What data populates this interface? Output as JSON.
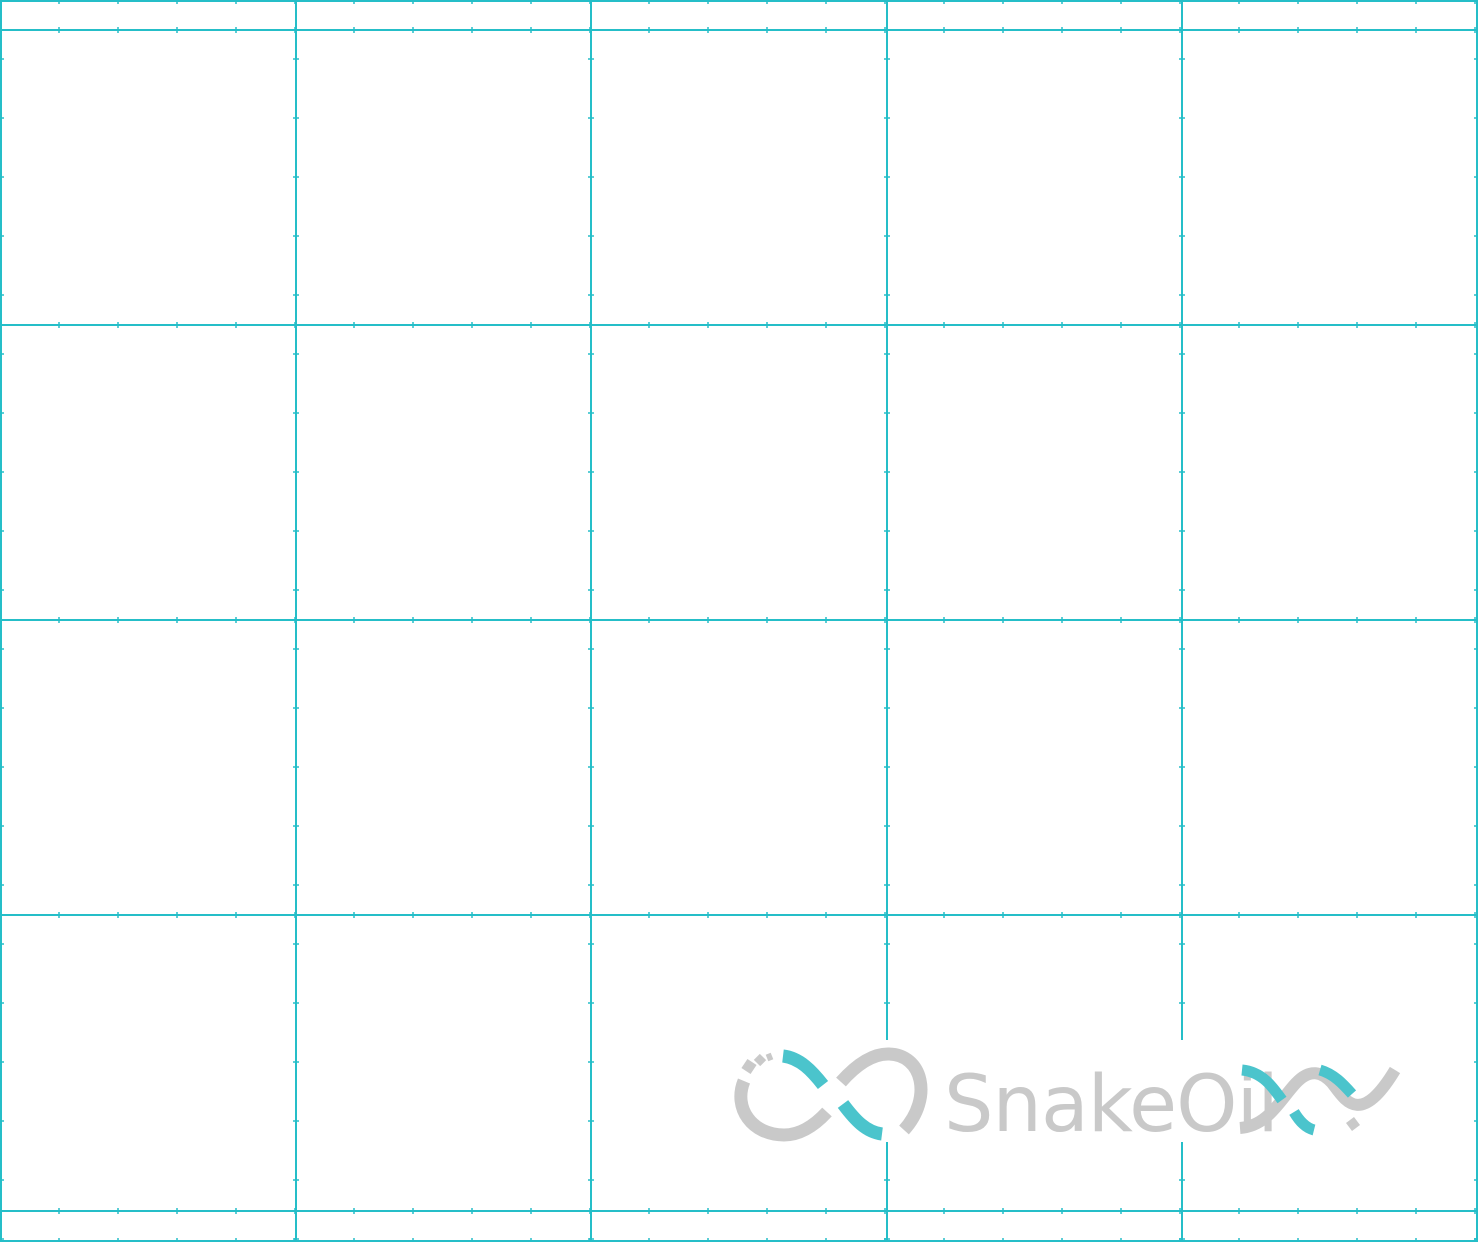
{
  "colors": {
    "background": "#ffffff",
    "grid_line": "#25bec8",
    "logo_gray": "#c9c9c9",
    "logo_teal": "#4bc4cc"
  },
  "grid": {
    "columns": 5,
    "rows": 4,
    "header_strip": true,
    "footer_strip": true,
    "tick_marks": true
  },
  "logo": {
    "icon": "infinity-loop-logo-icon",
    "wordmark": "SnakeOil",
    "accent_icon": "double-helix-icon"
  }
}
